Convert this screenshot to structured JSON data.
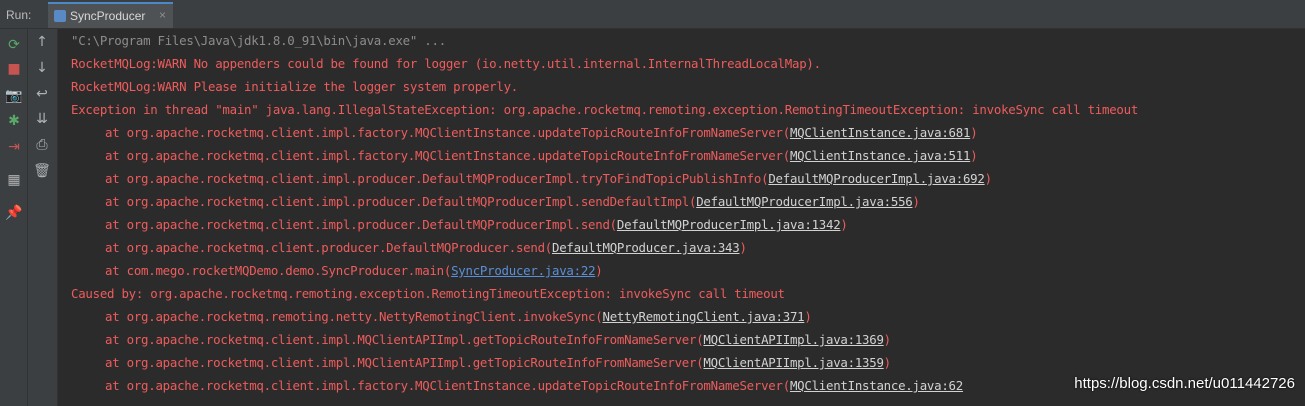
{
  "tabbar": {
    "run_label": "Run:",
    "tab_title": "SyncProducer",
    "close_glyph": "×",
    "tab_icon": "run-config-icon"
  },
  "toolbar_left": {
    "items": [
      {
        "name": "rerun-icon",
        "glyph": "⟳",
        "color": "#59a869"
      },
      {
        "name": "stop-icon",
        "glyph": "■",
        "color": "#c75450"
      },
      {
        "name": "camera-icon",
        "glyph": "📷",
        "color": "#afb1b3"
      },
      {
        "name": "debug-icon",
        "glyph": "✱",
        "color": "#59a869"
      },
      {
        "name": "exit-icon",
        "glyph": "⇥",
        "color": "#c75450"
      },
      {
        "name": "layout-icon",
        "glyph": "▦",
        "color": "#afb1b3"
      },
      {
        "name": "pin-icon",
        "glyph": "📌",
        "color": "#afb1b3"
      }
    ]
  },
  "toolbar_right": {
    "items": [
      {
        "name": "up-arrow-icon",
        "glyph": "↑"
      },
      {
        "name": "down-arrow-icon",
        "glyph": "↓"
      },
      {
        "name": "soft-wrap-icon",
        "glyph": "↩"
      },
      {
        "name": "scroll-to-end-icon",
        "glyph": "⇊"
      },
      {
        "name": "print-icon",
        "glyph": "⎙"
      },
      {
        "name": "trash-icon",
        "glyph": "🗑"
      }
    ]
  },
  "console": {
    "command": "\"C:\\Program Files\\Java\\jdk1.8.0_91\\bin\\java.exe\" ...",
    "lines": [
      {
        "text": "RocketMQLog:WARN No appenders could be found for logger (io.netty.util.internal.InternalThreadLocalMap)."
      },
      {
        "text": "RocketMQLog:WARN Please initialize the logger system properly."
      },
      {
        "text": "Exception in thread \"main\" java.lang.IllegalStateException: org.apache.rocketmq.remoting.exception.RemotingTimeoutException: invokeSync call timeout"
      },
      {
        "text": "at org.apache.rocketmq.client.impl.factory.MQClientInstance.updateTopicRouteInfoFromNameServer(",
        "link": "MQClientInstance.java:681",
        "suffix": ")"
      },
      {
        "text": "at org.apache.rocketmq.client.impl.factory.MQClientInstance.updateTopicRouteInfoFromNameServer(",
        "link": "MQClientInstance.java:511",
        "suffix": ")"
      },
      {
        "text": "at org.apache.rocketmq.client.impl.producer.DefaultMQProducerImpl.tryToFindTopicPublishInfo(",
        "link": "DefaultMQProducerImpl.java:692",
        "suffix": ")"
      },
      {
        "text": "at org.apache.rocketmq.client.impl.producer.DefaultMQProducerImpl.sendDefaultImpl(",
        "link": "DefaultMQProducerImpl.java:556",
        "suffix": ")"
      },
      {
        "text": "at org.apache.rocketmq.client.impl.producer.DefaultMQProducerImpl.send(",
        "link": "DefaultMQProducerImpl.java:1342",
        "suffix": ")"
      },
      {
        "text": "at org.apache.rocketmq.client.producer.DefaultMQProducer.send(",
        "link": "DefaultMQProducer.java:343",
        "suffix": ")"
      },
      {
        "text": "at com.mego.rocketMQDemo.demo.SyncProducer.main(",
        "link": "SyncProducer.java:22",
        "suffix": ")"
      },
      {
        "text": "Caused by: org.apache.rocketmq.remoting.exception.RemotingTimeoutException: invokeSync call timeout"
      },
      {
        "text": "at org.apache.rocketmq.remoting.netty.NettyRemotingClient.invokeSync(",
        "link": "NettyRemotingClient.java:371",
        "suffix": ")"
      },
      {
        "text": "at org.apache.rocketmq.client.impl.MQClientAPIImpl.getTopicRouteInfoFromNameServer(",
        "link": "MQClientAPIImpl.java:1369",
        "suffix": ")"
      },
      {
        "text": "at org.apache.rocketmq.client.impl.MQClientAPIImpl.getTopicRouteInfoFromNameServer(",
        "link": "MQClientAPIImpl.java:1359",
        "suffix": ")"
      },
      {
        "text": "at org.apache.rocketmq.client.impl.factory.MQClientInstance.updateTopicRouteInfoFromNameServer(",
        "link": "MQClientInstance.java:62",
        "suffix": ""
      }
    ]
  },
  "watermark": "https://blog.csdn.net/u011442726",
  "colors": {
    "error_text": "#ee5c5c",
    "command_text": "#8c8c8c",
    "link_text": "#d2d2d2",
    "user_link": "#5b8fd6",
    "background": "#2b2b2b"
  }
}
